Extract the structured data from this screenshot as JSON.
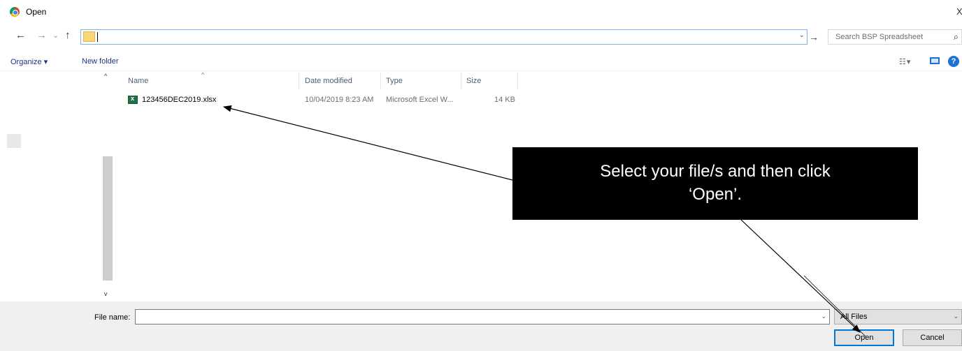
{
  "window": {
    "title": "Open",
    "close_symbol": "X"
  },
  "nav": {
    "back": "←",
    "forward": "→",
    "recent": "⌄",
    "up": "↑"
  },
  "address": {
    "value": "",
    "dropdown": "⌄",
    "go": "→"
  },
  "search": {
    "placeholder": "Search BSP Spreadsheet",
    "icon": "search-icon"
  },
  "toolbar": {
    "organize_label": "Organize ▾",
    "new_folder_label": "New folder",
    "views_label": "☷ ▾",
    "help_label": "?"
  },
  "filelist": {
    "columns": [
      "Name",
      "Date modified",
      "Type",
      "Size"
    ],
    "sort_indicator": "^",
    "rows": [
      {
        "name": "123456DEC2019.xlsx",
        "date_modified": "10/04/2019 8:23 AM",
        "type": "Microsoft Excel W...",
        "size": "14 KB"
      }
    ]
  },
  "scroll": {
    "up": "^",
    "down": "v"
  },
  "footer": {
    "file_name_label": "File name:",
    "file_name_value": "",
    "file_type_value": "All Files",
    "open_label": "Open",
    "cancel_label": "Cancel"
  },
  "callout": {
    "line1": "Select your file/s and then click",
    "line2": "‘Open’."
  }
}
